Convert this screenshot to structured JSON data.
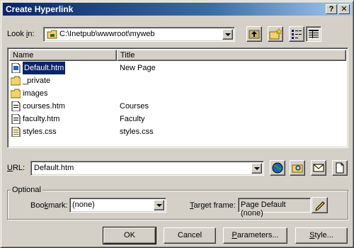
{
  "window": {
    "title": "Create Hyperlink",
    "help_glyph": "?",
    "close_glyph": "✕"
  },
  "look_in": {
    "label_prefix": "Look ",
    "label_hotkey": "i",
    "label_suffix": "n:",
    "value": "C:\\Inetpub\\wwwroot\\myweb"
  },
  "toolbar": {
    "icons": [
      "up-folder-icon",
      "new-folder-icon",
      "list-view-icon",
      "details-view-icon"
    ]
  },
  "file_list": {
    "columns": [
      "Name",
      "Title"
    ],
    "rows": [
      {
        "name": "Default.htm",
        "title": "New Page",
        "type": "html-file",
        "selected": true
      },
      {
        "name": "_private",
        "title": "",
        "type": "folder",
        "selected": false
      },
      {
        "name": "images",
        "title": "",
        "type": "folder",
        "selected": false
      },
      {
        "name": "courses.htm",
        "title": "Courses",
        "type": "html-file",
        "selected": false
      },
      {
        "name": "faculty.htm",
        "title": "Faculty",
        "type": "html-file",
        "selected": false
      },
      {
        "name": "styles.css",
        "title": "styles.css",
        "type": "css-file",
        "selected": false
      }
    ]
  },
  "url": {
    "label_hotkey": "U",
    "label_suffix": "RL:",
    "value": "Default.htm"
  },
  "optional": {
    "group_label": "Optional",
    "bookmark_label_prefix": "Boo",
    "bookmark_label_hotkey": "k",
    "bookmark_label_suffix": "mark:",
    "bookmark_value": "(none)",
    "target_label_hotkey": "T",
    "target_label_suffix": "arget frame:",
    "target_value": "Page Default (none)"
  },
  "buttons": {
    "ok": "OK",
    "cancel": "Cancel",
    "parameters_hotkey": "P",
    "parameters_rest": "arameters...",
    "style_hotkey": "S",
    "style_rest": "tyle..."
  },
  "colors": {
    "title_gradient_start": "#0a246a",
    "title_gradient_end": "#a6caf0",
    "selection": "#0a246a",
    "dialog_face": "#d4d0c8"
  }
}
